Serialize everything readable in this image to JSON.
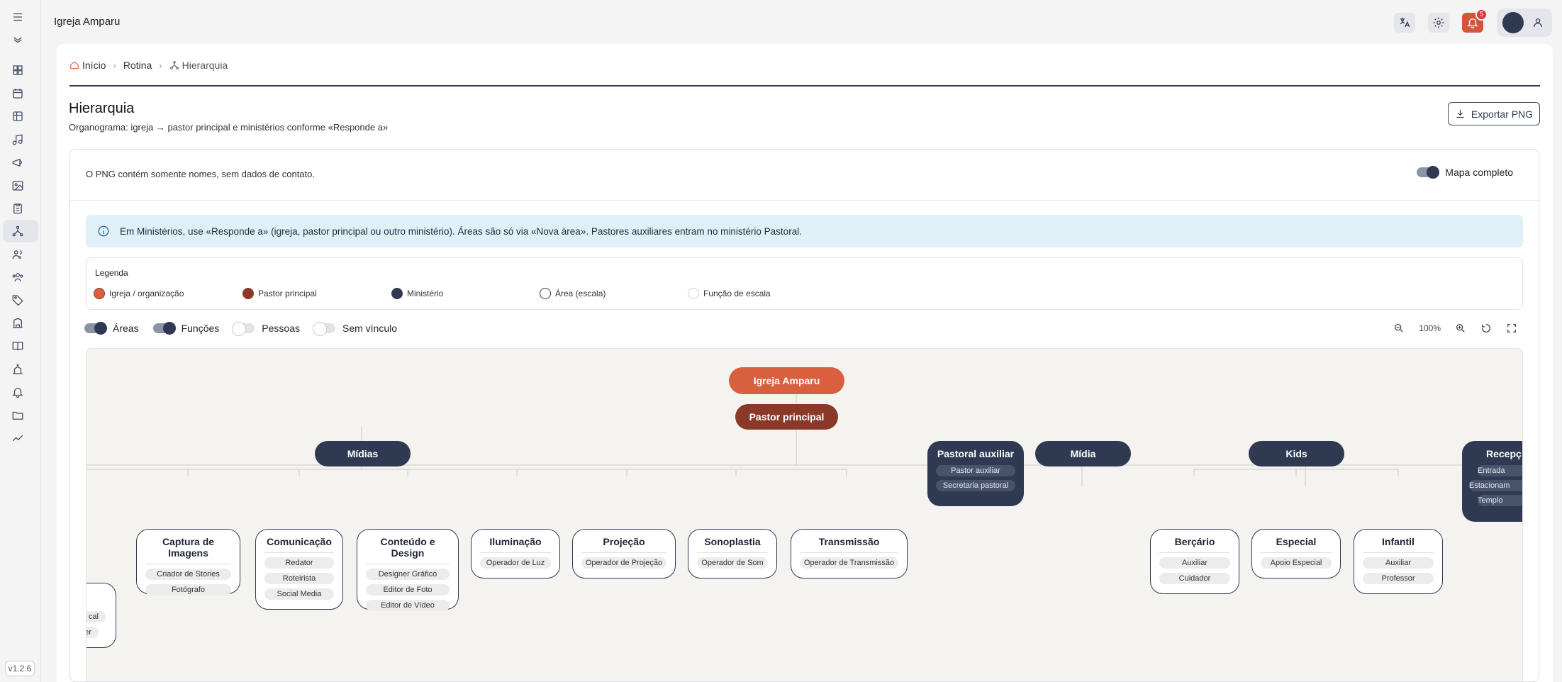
{
  "app": {
    "title": "Igreja Amparu",
    "version": "v1.2.6"
  },
  "topbar": {
    "notifications_count": "5"
  },
  "breadcrumb": {
    "items": [
      "Início",
      "Rotina",
      "Hierarquia"
    ]
  },
  "page": {
    "title": "Hierarquia",
    "subtitle": "Organograma: igreja → pastor principal e ministérios conforme «Responde a»",
    "export_label": "Exportar PNG"
  },
  "card": {
    "note": "O PNG contém somente nomes, sem dados de contato.",
    "map_toggle_label": "Mapa completo"
  },
  "info": "Em Ministérios, use «Responde a» (igreja, pastor principal ou outro ministério). Áreas são só via «Nova área». Pastores auxiliares entram no ministério Pastoral.",
  "legend": {
    "title": "Legenda",
    "items": [
      {
        "label": "Igreja / organização",
        "color": "#d9603f"
      },
      {
        "label": "Pastor principal",
        "color": "#8a3827"
      },
      {
        "label": "Ministério",
        "color": "#2f3a52"
      },
      {
        "label": "Área (escala)",
        "color": "#ffffff"
      },
      {
        "label": "Função de escala",
        "color": "#ffffff"
      }
    ]
  },
  "filters": [
    {
      "label": "Áreas",
      "on": true
    },
    {
      "label": "Funções",
      "on": true
    },
    {
      "label": "Pessoas",
      "on": false
    },
    {
      "label": "Sem vínculo",
      "on": false
    }
  ],
  "zoom": {
    "level": "100%"
  },
  "tree": {
    "root": "Igreja Amparu",
    "pastor": "Pastor principal",
    "ministries": {
      "midias": "Mídias",
      "pastoral": {
        "title": "Pastoral auxiliar",
        "roles": [
          "Pastor auxiliar",
          "Secretaria pastoral"
        ]
      },
      "midia": "Mídia",
      "kids": "Kids",
      "recepcao": {
        "title": "Recepç",
        "roles": [
          "Entrada",
          "Estacionam",
          "Templo"
        ]
      }
    },
    "partial_area": {
      "roles": [
        "cal",
        "der"
      ]
    },
    "areas": [
      {
        "title": "Captura de Imagens",
        "roles": [
          "Criador de Stories",
          "Fotógrafo"
        ]
      },
      {
        "title": "Comunicação",
        "roles": [
          "Redator",
          "Roteirista",
          "Social Media"
        ]
      },
      {
        "title": "Conteúdo e Design",
        "roles": [
          "Designer Gráfico",
          "Editor de Foto",
          "Editor de Vídeo"
        ]
      },
      {
        "title": "Iluminação",
        "roles": [
          "Operador de Luz"
        ]
      },
      {
        "title": "Projeção",
        "roles": [
          "Operador de Projeção"
        ]
      },
      {
        "title": "Sonoplastia",
        "roles": [
          "Operador de Som"
        ]
      },
      {
        "title": "Transmissão",
        "roles": [
          "Operador de Transmissão"
        ]
      },
      {
        "title": "Berçário",
        "roles": [
          "Auxiliar",
          "Cuidador"
        ]
      },
      {
        "title": "Especial",
        "roles": [
          "Apoio Especial"
        ]
      },
      {
        "title": "Infantil",
        "roles": [
          "Auxiliar",
          "Professor"
        ]
      }
    ]
  }
}
